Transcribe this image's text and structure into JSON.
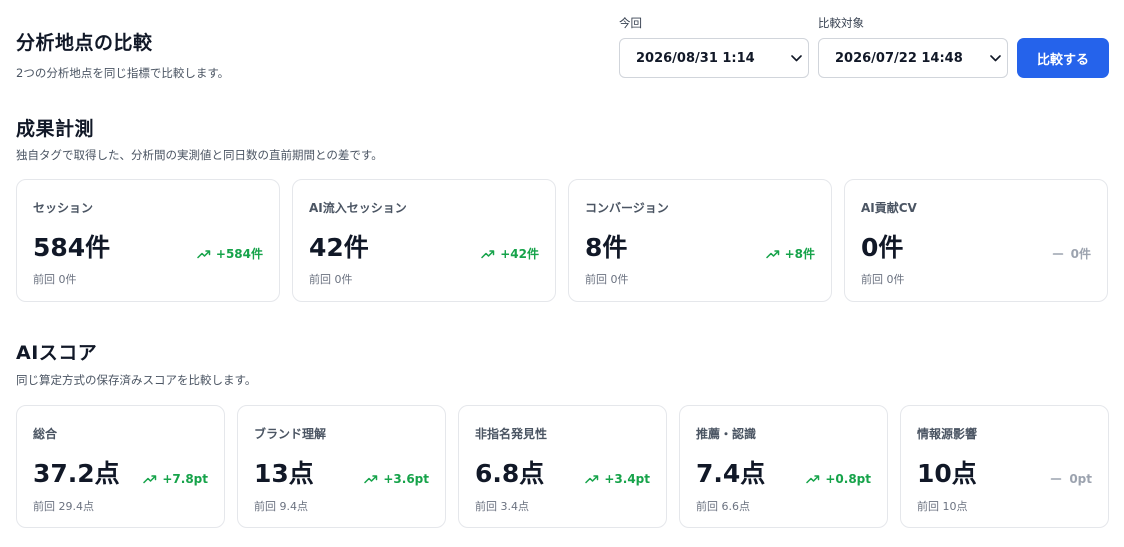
{
  "header": {
    "title": "分析地点の比較",
    "subtitle": "2つの分析地点を同じ指標で比較します。"
  },
  "controls": {
    "current_label": "今回",
    "current_value": "2026/08/31 1:14",
    "compare_label": "比較対象",
    "compare_value": "2026/07/22 14:48",
    "compare_button": "比較する"
  },
  "results": {
    "title": "成果計測",
    "description": "独自タグで取得した、分析間の実測値と同日数の直前期間との差です。",
    "cards": [
      {
        "label": "セッション",
        "value": "584件",
        "delta": "+584件",
        "trend": "up",
        "previous": "前回 0件"
      },
      {
        "label": "AI流入セッション",
        "value": "42件",
        "delta": "+42件",
        "trend": "up",
        "previous": "前回 0件"
      },
      {
        "label": "コンバージョン",
        "value": "8件",
        "delta": "+8件",
        "trend": "up",
        "previous": "前回 0件"
      },
      {
        "label": "AI貢献CV",
        "value": "0件",
        "delta": "0件",
        "trend": "flat",
        "previous": "前回 0件"
      }
    ]
  },
  "ai_score": {
    "title": "AIスコア",
    "description": "同じ算定方式の保存済みスコアを比較します。",
    "cards": [
      {
        "label": "総合",
        "value": "37.2点",
        "delta": "+7.8pt",
        "trend": "up",
        "previous": "前回 29.4点"
      },
      {
        "label": "ブランド理解",
        "value": "13点",
        "delta": "+3.6pt",
        "trend": "up",
        "previous": "前回 9.4点"
      },
      {
        "label": "非指名発見性",
        "value": "6.8点",
        "delta": "+3.4pt",
        "trend": "up",
        "previous": "前回 3.4点"
      },
      {
        "label": "推薦・認識",
        "value": "7.4点",
        "delta": "+0.8pt",
        "trend": "up",
        "previous": "前回 6.6点"
      },
      {
        "label": "情報源影響",
        "value": "10点",
        "delta": "0pt",
        "trend": "flat",
        "previous": "前回 10点"
      }
    ]
  },
  "colors": {
    "accent": "#2563eb",
    "positive": "#16a34a",
    "neutral": "#9ca3af"
  },
  "icons": {
    "up": "trending-up-icon",
    "flat": "minus-icon",
    "select": "chevron-down-icon"
  }
}
